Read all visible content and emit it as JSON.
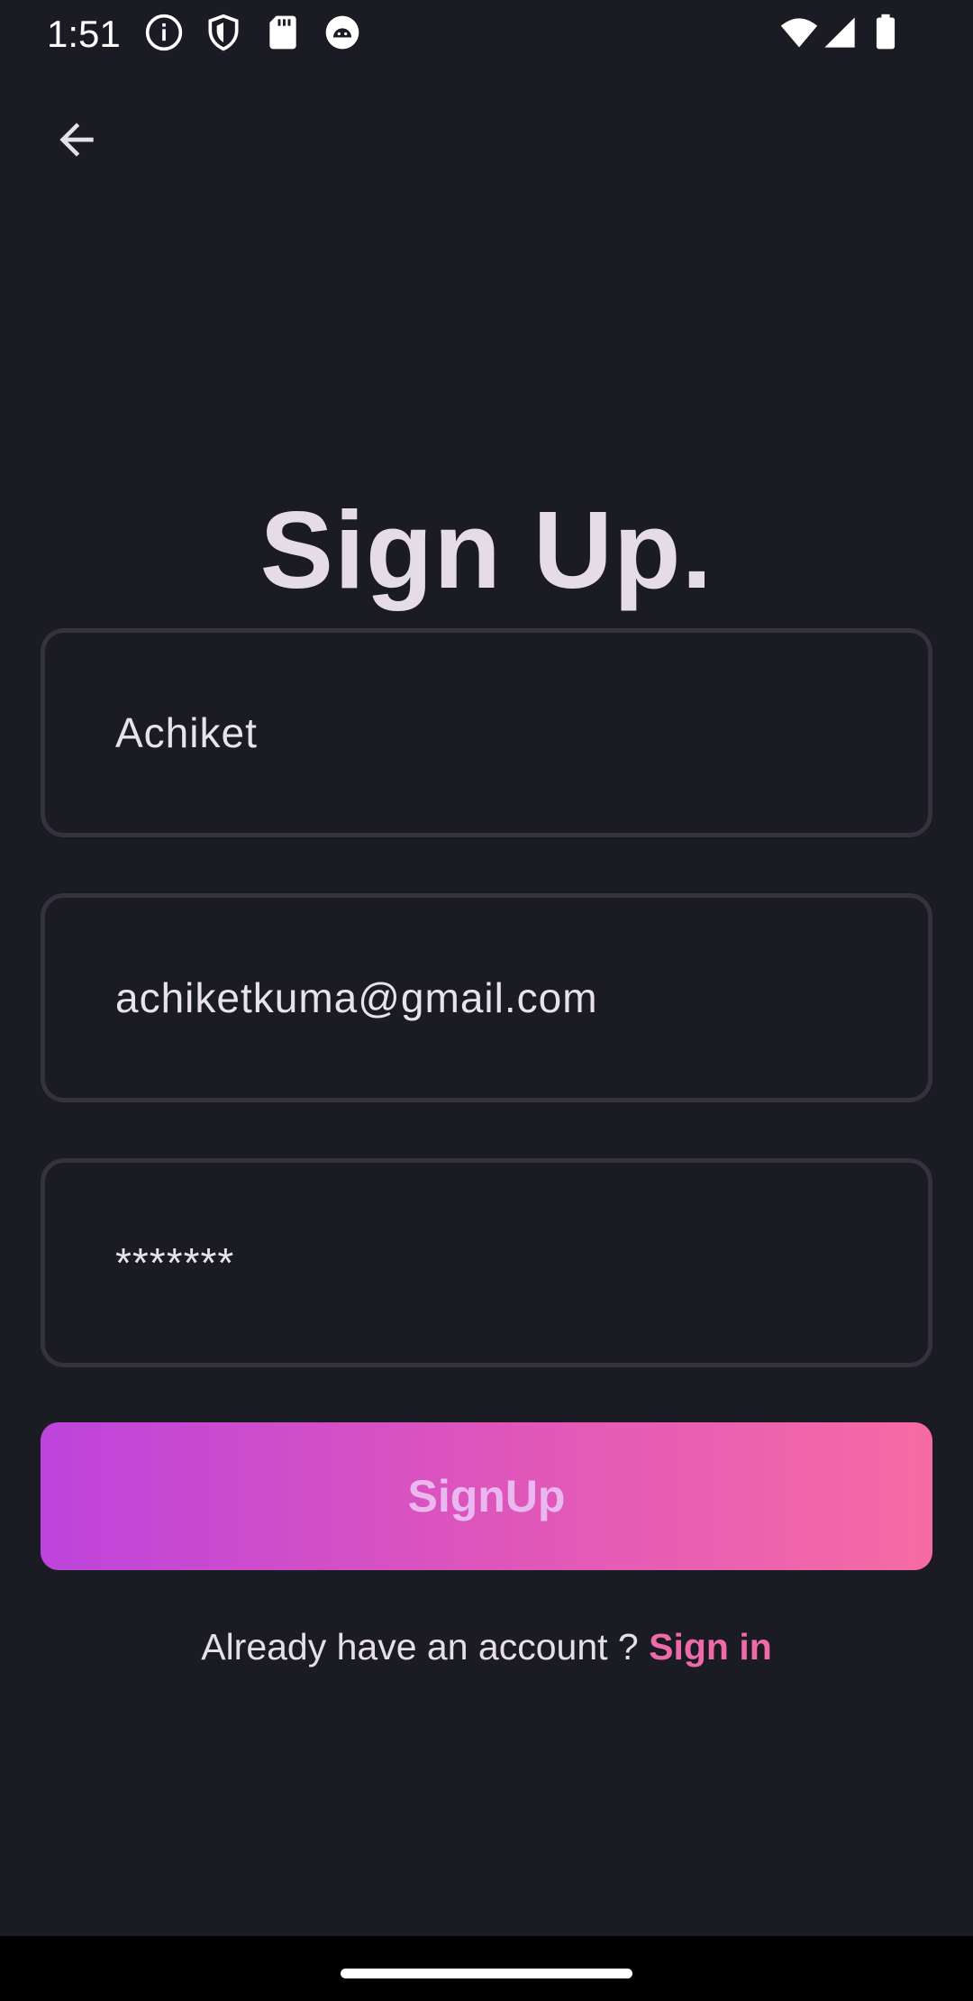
{
  "status_bar": {
    "time": "1:51",
    "left_icons": [
      "info-icon",
      "shield-icon",
      "sd-card-icon",
      "android-debug-icon"
    ],
    "right_icons": [
      "wifi-icon",
      "cellular-signal-icon",
      "battery-icon"
    ]
  },
  "header": {
    "back_icon": "arrow-back-icon"
  },
  "form": {
    "title": "Sign Up.",
    "name_value": "Achiket",
    "email_value": "achiketkuma@gmail.com",
    "password_value": "*******",
    "submit_label": "SignUp"
  },
  "footer": {
    "prompt": "Already have an account ? ",
    "link_label": "Sign in"
  },
  "colors": {
    "background": "#1b1b24",
    "field_border": "#33323d",
    "gradient_start": "#bd44dc",
    "gradient_end": "#f76ba4",
    "link": "#ef6aa9"
  }
}
